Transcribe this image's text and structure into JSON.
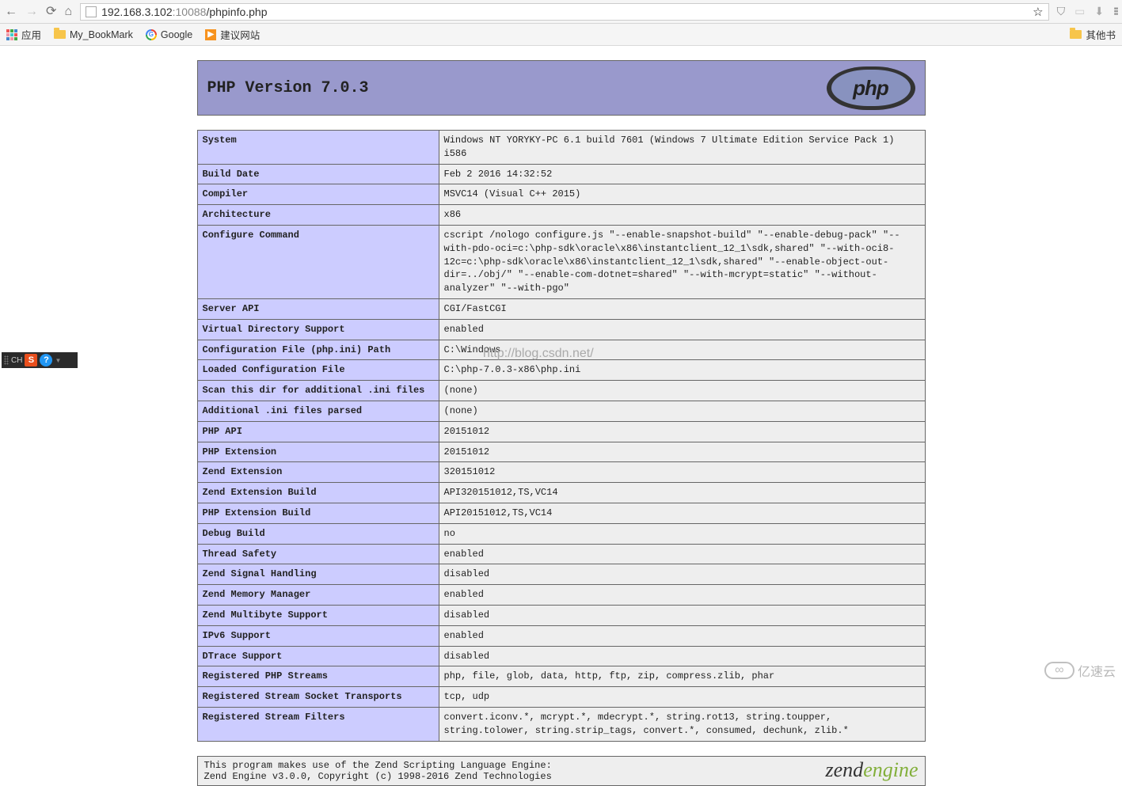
{
  "browser": {
    "url_host": "192.168.3.102",
    "url_port": ":10088",
    "url_path": "/phpinfo.php"
  },
  "bookmarks": {
    "apps": "应用",
    "my_bookmark": "My_BookMark",
    "google": "Google",
    "suggested": "建议网站",
    "other": "其他书"
  },
  "float_tool": {
    "lang": "CH",
    "sogou": "S",
    "help": "?"
  },
  "header": {
    "title": "PHP Version 7.0.3",
    "logo_text": "php"
  },
  "rows": [
    {
      "k": "System",
      "v": "Windows NT YORYKY-PC 6.1 build 7601 (Windows 7 Ultimate Edition Service Pack 1) i586"
    },
    {
      "k": "Build Date",
      "v": "Feb 2 2016 14:32:52"
    },
    {
      "k": "Compiler",
      "v": "MSVC14 (Visual C++ 2015)"
    },
    {
      "k": "Architecture",
      "v": "x86"
    },
    {
      "k": "Configure Command",
      "v": "cscript /nologo configure.js \"--enable-snapshot-build\" \"--enable-debug-pack\" \"--with-pdo-oci=c:\\php-sdk\\oracle\\x86\\instantclient_12_1\\sdk,shared\" \"--with-oci8-12c=c:\\php-sdk\\oracle\\x86\\instantclient_12_1\\sdk,shared\" \"--enable-object-out-dir=../obj/\" \"--enable-com-dotnet=shared\" \"--with-mcrypt=static\" \"--without-analyzer\" \"--with-pgo\""
    },
    {
      "k": "Server API",
      "v": "CGI/FastCGI"
    },
    {
      "k": "Virtual Directory Support",
      "v": "enabled"
    },
    {
      "k": "Configuration File (php.ini) Path",
      "v": "C:\\Windows"
    },
    {
      "k": "Loaded Configuration File",
      "v": "C:\\php-7.0.3-x86\\php.ini"
    },
    {
      "k": "Scan this dir for additional .ini files",
      "v": "(none)"
    },
    {
      "k": "Additional .ini files parsed",
      "v": "(none)"
    },
    {
      "k": "PHP API",
      "v": "20151012"
    },
    {
      "k": "PHP Extension",
      "v": "20151012"
    },
    {
      "k": "Zend Extension",
      "v": "320151012"
    },
    {
      "k": "Zend Extension Build",
      "v": "API320151012,TS,VC14"
    },
    {
      "k": "PHP Extension Build",
      "v": "API20151012,TS,VC14"
    },
    {
      "k": "Debug Build",
      "v": "no"
    },
    {
      "k": "Thread Safety",
      "v": "enabled"
    },
    {
      "k": "Zend Signal Handling",
      "v": "disabled"
    },
    {
      "k": "Zend Memory Manager",
      "v": "enabled"
    },
    {
      "k": "Zend Multibyte Support",
      "v": "disabled"
    },
    {
      "k": "IPv6 Support",
      "v": "enabled"
    },
    {
      "k": "DTrace Support",
      "v": "disabled"
    },
    {
      "k": "Registered PHP Streams",
      "v": "php, file, glob, data, http, ftp, zip, compress.zlib, phar"
    },
    {
      "k": "Registered Stream Socket Transports",
      "v": "tcp, udp"
    },
    {
      "k": "Registered Stream Filters",
      "v": "convert.iconv.*, mcrypt.*, mdecrypt.*, string.rot13, string.toupper, string.tolower, string.strip_tags, convert.*, consumed, dechunk, zlib.*"
    }
  ],
  "footer": {
    "line1": "This program makes use of the Zend Scripting Language Engine:",
    "line2": "Zend Engine v3.0.0, Copyright (c) 1998-2016 Zend Technologies"
  },
  "watermarks": {
    "csdn": "http://blog.csdn.net/",
    "ysy": "亿速云"
  }
}
